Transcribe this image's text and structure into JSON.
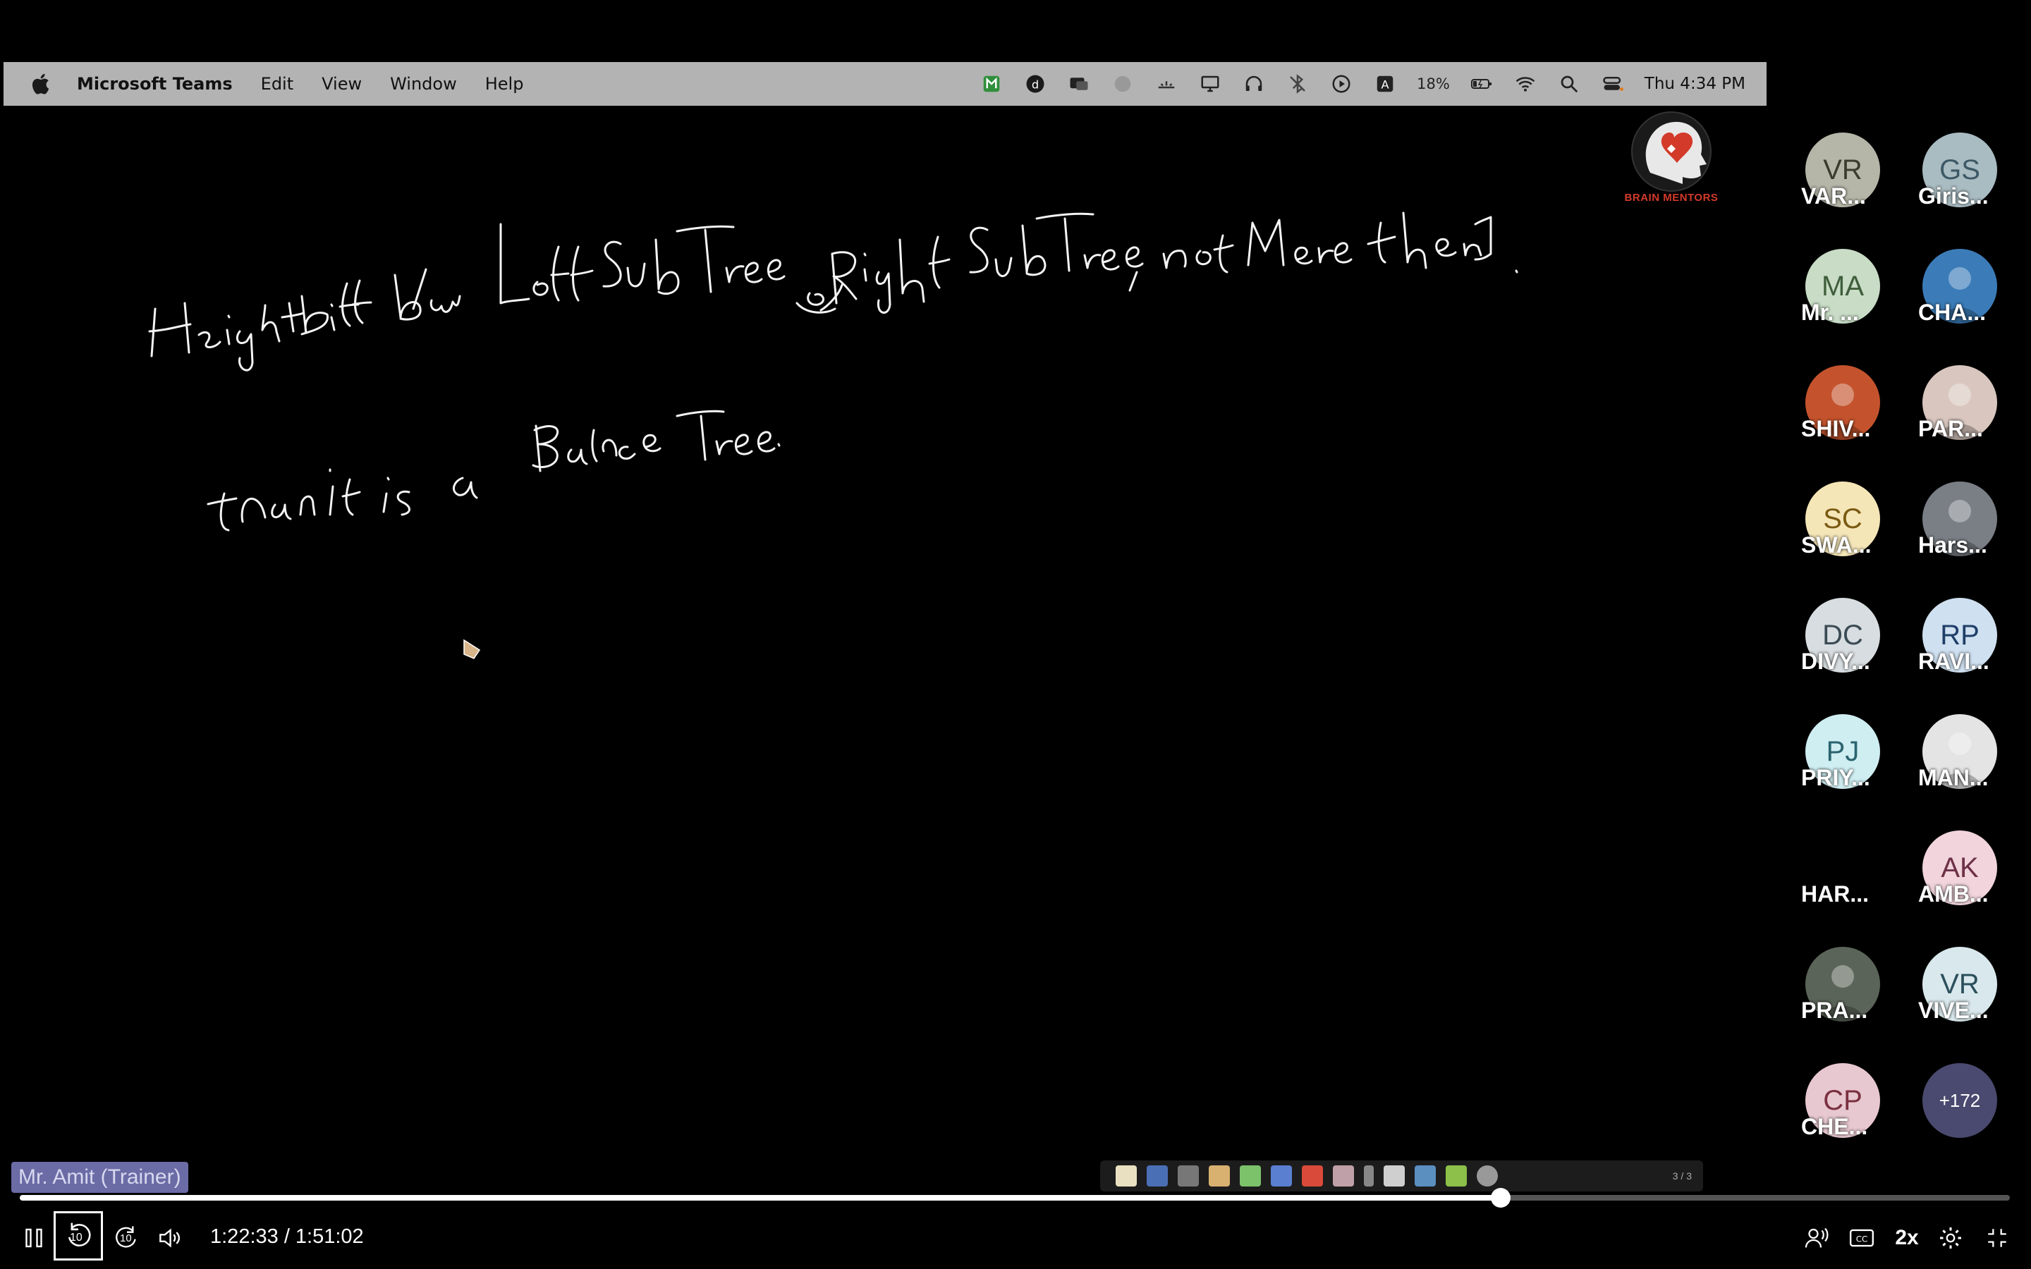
{
  "menubar": {
    "app_name": "Microsoft Teams",
    "menus": [
      "Edit",
      "View",
      "Window",
      "Help"
    ],
    "battery": "18%",
    "clock": "Thu 4:34 PM"
  },
  "board": {
    "ink_color": "#ffffff",
    "handwriting_lines": [
      "Height Diff b/w left Sub Tree & Right Sub Tree , not More than 1 .",
      "than it is a Balance Tree."
    ]
  },
  "logo": {
    "text": "BRAIN MENTORS"
  },
  "participants": [
    {
      "initials": "VR",
      "name": "VAR...",
      "bg": "#b5b5a8",
      "fg": "#3b3b2f",
      "photo": false
    },
    {
      "initials": "GS",
      "name": "Giris...",
      "bg": "#a9bcc2",
      "fg": "#3d5966",
      "photo": false
    },
    {
      "initials": "MA",
      "name": "Mr. ...",
      "bg": "#c8dcc6",
      "fg": "#3f5d3b",
      "photo": false
    },
    {
      "initials": "",
      "name": "CHA...",
      "bg": "#3b7cb8",
      "fg": "#fff",
      "photo": true
    },
    {
      "initials": "",
      "name": "SHIV...",
      "bg": "#c4532d",
      "fg": "#fff",
      "photo": true
    },
    {
      "initials": "",
      "name": "PAR...",
      "bg": "#d9c7bf",
      "fg": "#fff",
      "photo": true
    },
    {
      "initials": "SC",
      "name": "SWA...",
      "bg": "#f5e6b8",
      "fg": "#7a5a12",
      "photo": false
    },
    {
      "initials": "",
      "name": "Hars...",
      "bg": "#7a7f86",
      "fg": "#fff",
      "photo": true
    },
    {
      "initials": "DC",
      "name": "DIVY...",
      "bg": "#d7dde0",
      "fg": "#3b4b55",
      "photo": false
    },
    {
      "initials": "RP",
      "name": "RAVI...",
      "bg": "#cfe0f0",
      "fg": "#1f3e68",
      "photo": false
    },
    {
      "initials": "PJ",
      "name": "PRIY...",
      "bg": "#cfeef2",
      "fg": "#2a6470",
      "photo": false
    },
    {
      "initials": "",
      "name": "MAN...",
      "bg": "#e4e4e4",
      "fg": "#fff",
      "photo": true
    },
    {
      "initials": "",
      "name": "HAR...",
      "bg": "#000000",
      "fg": "#fff",
      "photo": false
    },
    {
      "initials": "AK",
      "name": "AMB...",
      "bg": "#f1d4dc",
      "fg": "#6e3148",
      "photo": false
    },
    {
      "initials": "",
      "name": "PRA...",
      "bg": "#5b6458",
      "fg": "#fff",
      "photo": true
    },
    {
      "initials": "VR",
      "name": "VIVE...",
      "bg": "#d9e8ec",
      "fg": "#2b4f5c",
      "photo": false
    },
    {
      "initials": "CP",
      "name": "CHE...",
      "bg": "#e8c8d0",
      "fg": "#7a3040",
      "photo": false
    }
  ],
  "overflow_count": "+172",
  "presenter": "Mr. Amit (Trainer)",
  "annotation_toolbar": {
    "page": "3 / 3"
  },
  "player": {
    "current": "1:22:33",
    "duration": "1:51:02",
    "time_text": "1:22:33 / 1:51:02",
    "progress_fraction": 0.744,
    "skip_back": "10",
    "skip_forward": "10",
    "rate": "2x"
  }
}
